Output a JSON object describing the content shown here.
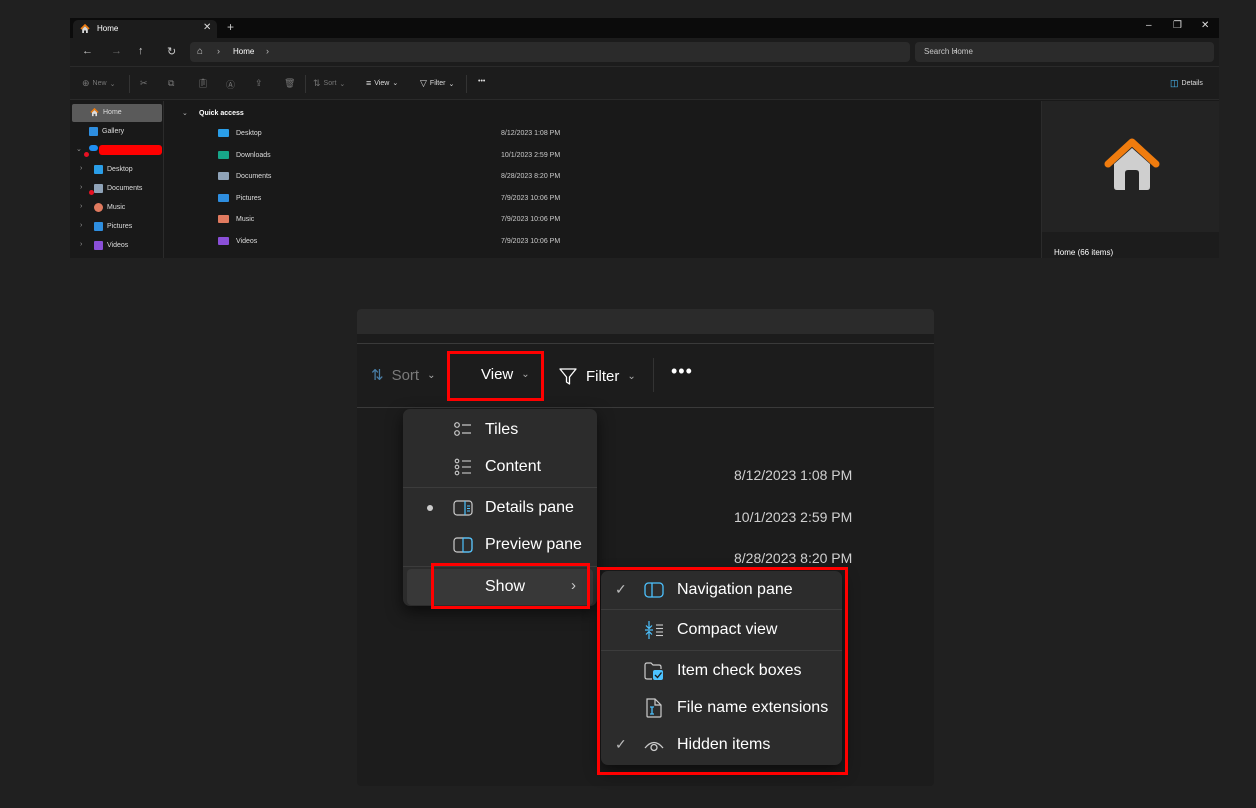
{
  "explorer": {
    "tab": {
      "title": "Home",
      "close": "✕",
      "new_tab": "+"
    },
    "window_controls": {
      "minimize": "–",
      "maximize": "❐",
      "close": "✕"
    },
    "nav_buttons": {
      "back": "←",
      "forward": "→",
      "up": "↑",
      "refresh": "↻"
    },
    "address": {
      "home_icon": "⌂",
      "sep": "›",
      "path": "Home",
      "sep_after": "›"
    },
    "search": {
      "placeholder": "Search Home",
      "icon": "⌕"
    },
    "command_bar": {
      "new_label": "New",
      "sort_label": "Sort",
      "view_label": "View",
      "filter_label": "Filter",
      "more_label": "•••",
      "details_label": "Details",
      "chevron": "⌄"
    },
    "nav_pane": {
      "items": [
        {
          "label": "Home",
          "selected": true
        },
        {
          "label": "Gallery"
        },
        {
          "label": "",
          "redacted": true
        },
        {
          "label": "Desktop"
        },
        {
          "label": "Documents"
        },
        {
          "label": "Music"
        },
        {
          "label": "Pictures"
        },
        {
          "label": "Videos"
        }
      ]
    },
    "quick_access": {
      "header": "Quick access",
      "items": [
        {
          "name": "Desktop",
          "date": "8/12/2023 1:08 PM",
          "color": "#2a9ee8"
        },
        {
          "name": "Downloads",
          "date": "10/1/2023 2:59 PM",
          "color": "#17a589"
        },
        {
          "name": "Documents",
          "date": "8/28/2023 8:20 PM",
          "color": "#8fa3b8"
        },
        {
          "name": "Pictures",
          "date": "7/9/2023 10:06 PM",
          "color": "#2e8ee0"
        },
        {
          "name": "Music",
          "date": "7/9/2023 10:06 PM",
          "color": "#e07a5f"
        },
        {
          "name": "Videos",
          "date": "7/9/2023 10:06 PM",
          "color": "#8a4fd8"
        }
      ]
    },
    "details_pane": {
      "title": "Home (66 items)"
    }
  },
  "zoomed": {
    "sort_label": "Sort",
    "view_label": "View",
    "filter_label": "Filter",
    "more_label": "•••",
    "chevron": "⌄",
    "dates": [
      "8/12/2023 1:08 PM",
      "10/1/2023 2:59 PM",
      "8/28/2023 8:20 PM"
    ],
    "view_menu": {
      "items": [
        {
          "label": "Tiles",
          "icon": "tiles-icon"
        },
        {
          "label": "Content",
          "icon": "content-icon"
        },
        {
          "label": "Details pane",
          "icon": "details-pane-icon",
          "selected": true
        },
        {
          "label": "Preview pane",
          "icon": "preview-pane-icon"
        },
        {
          "label": "Show",
          "icon": "",
          "submenu_arrow": "›"
        }
      ]
    },
    "show_submenu": {
      "check": "✓",
      "items": [
        {
          "label": "Navigation pane",
          "checked": true
        },
        {
          "label": "Compact view",
          "checked": false
        },
        {
          "label": "Item check boxes",
          "checked": false
        },
        {
          "label": "File name extensions",
          "checked": false
        },
        {
          "label": "Hidden items",
          "checked": true
        }
      ]
    },
    "highlight_color": "#ff0000"
  }
}
